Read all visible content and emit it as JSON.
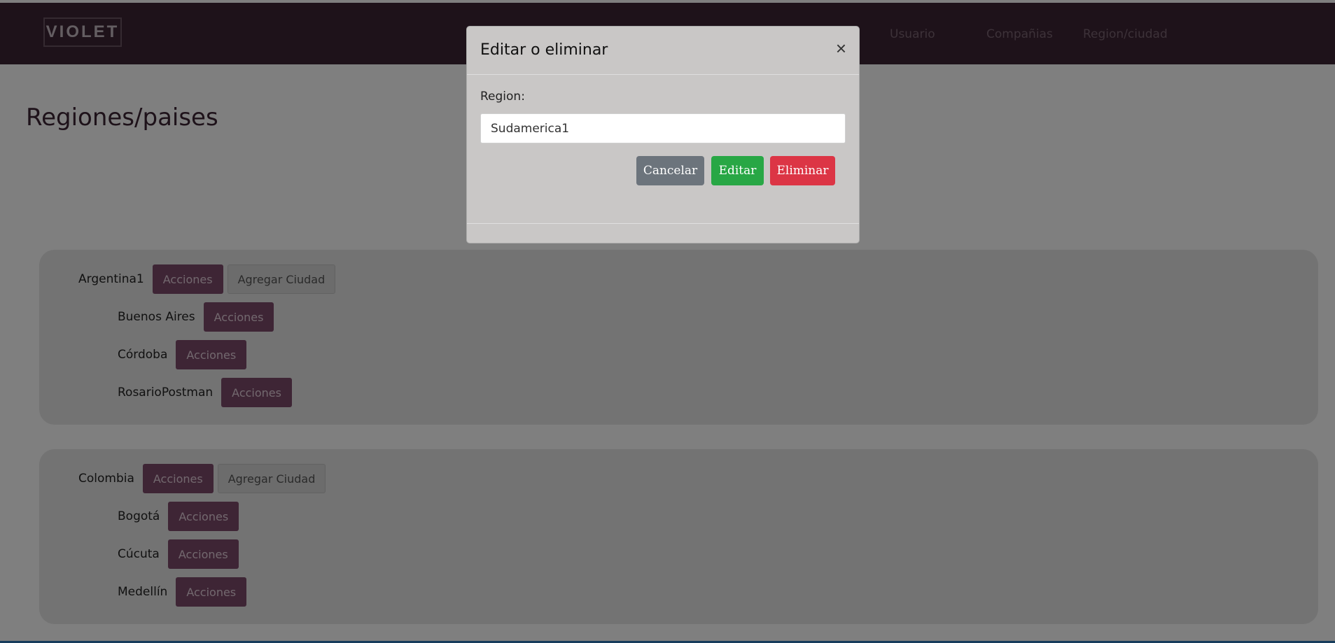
{
  "navbar": {
    "logo": "VIOLET",
    "links": [
      "Usuario",
      "Compañias",
      "Region/ciudad"
    ]
  },
  "page": {
    "title": "Regiones/paises"
  },
  "cards": [
    {
      "country": "Argentina1",
      "actions_label": "Acciones",
      "add_city_label": "Agregar Ciudad",
      "cities": [
        {
          "name": "Buenos Aires",
          "actions_label": "Acciones"
        },
        {
          "name": "Córdoba",
          "actions_label": "Acciones"
        },
        {
          "name": "RosarioPostman",
          "actions_label": "Acciones"
        }
      ]
    },
    {
      "country": "Colombia",
      "actions_label": "Acciones",
      "add_city_label": "Agregar Ciudad",
      "cities": [
        {
          "name": "Bogotá",
          "actions_label": "Acciones"
        },
        {
          "name": "Cúcuta",
          "actions_label": "Acciones"
        },
        {
          "name": "Medellín",
          "actions_label": "Acciones"
        }
      ]
    }
  ],
  "modal": {
    "title": "Editar o eliminar",
    "close_icon": "×",
    "field_label": "Region:",
    "field_value": "Sudamerica1",
    "cancel_label": "Cancelar",
    "edit_label": "Editar",
    "delete_label": "Eliminar"
  },
  "colors": {
    "navbar": "#3c2434",
    "accent": "#7d4a6b",
    "cancel": "#6c747c",
    "edit": "#28a745",
    "delete": "#dc3545"
  }
}
